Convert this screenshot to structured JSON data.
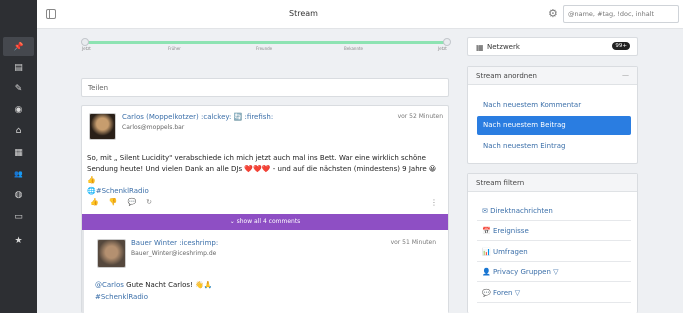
{
  "header": {
    "title": "Stream",
    "search_placeholder": "@name, #tag, !doc, inhalt"
  },
  "sidebar": {
    "items": [
      {
        "icon": "pin-icon",
        "glyph": "📌"
      },
      {
        "icon": "newspaper-icon",
        "glyph": "▤"
      },
      {
        "icon": "pencil-icon",
        "glyph": "✎"
      },
      {
        "icon": "user-circle-icon",
        "glyph": "◉"
      },
      {
        "icon": "home-icon",
        "glyph": "⌂"
      },
      {
        "icon": "grid-icon",
        "glyph": "▦"
      },
      {
        "icon": "users-icon",
        "glyph": "👥"
      },
      {
        "icon": "globe-icon",
        "glyph": "◍"
      },
      {
        "icon": "message-icon",
        "glyph": "▭"
      },
      {
        "icon": "star-icon",
        "glyph": "★"
      }
    ]
  },
  "timeline": {
    "labels": [
      "Jetzt",
      "Früher",
      "Freunde",
      "Bekannte",
      "Jetzt"
    ]
  },
  "share": {
    "placeholder": "Teilen"
  },
  "post": {
    "author": "Carlos (Moppelkotzer) :calckey: 🔄 :firefish:",
    "handle": "Carlos@moppels.bar",
    "time": "vor 52 Minuten",
    "body_main": "So, mit „ Silent Lucidity\" verabschiede ich mich jetzt auch mal ins Bett. War eine wirklich schöne Sendung heute! Und vielen Dank an alle DJs",
    "hearts": "❤️❤️❤️",
    "body_tail": " - und auf die nächsten (mindestens) 9 Jahre 😀👍",
    "tag": "🌐#SchenklRadio",
    "show_all": "⌄ show all 4 comments"
  },
  "comment": {
    "author": "Bauer Winter :iceshrimp:",
    "handle": "Bauer_Winter@iceshrimp.de",
    "time": "vor 51 Minuten",
    "mention": "@Carlos",
    "text": " Gute Nacht Carlos! 👋🙏",
    "tag": "#SchenklRadio"
  },
  "network": {
    "label": "Netzwerk",
    "badge": "99+"
  },
  "order": {
    "title": "Stream anordnen",
    "items": [
      "Nach neuestem Kommentar",
      "Nach neuestem Beitrag",
      "Nach neuestem Eintrag"
    ],
    "active_index": 1
  },
  "filter": {
    "title": "Stream filtern",
    "items": [
      "✉ Direktnachrichten",
      "📅 Ereignisse",
      "📊 Umfragen",
      "👤 Privacy Gruppen ▽",
      "💬 Foren ▽"
    ]
  },
  "colors": {
    "accent": "#2a7de1",
    "show_all_bar": "#8e4fc4",
    "link": "#3b6fa9",
    "slider": "#8de3b2",
    "sidebar": "#2d2f33"
  }
}
